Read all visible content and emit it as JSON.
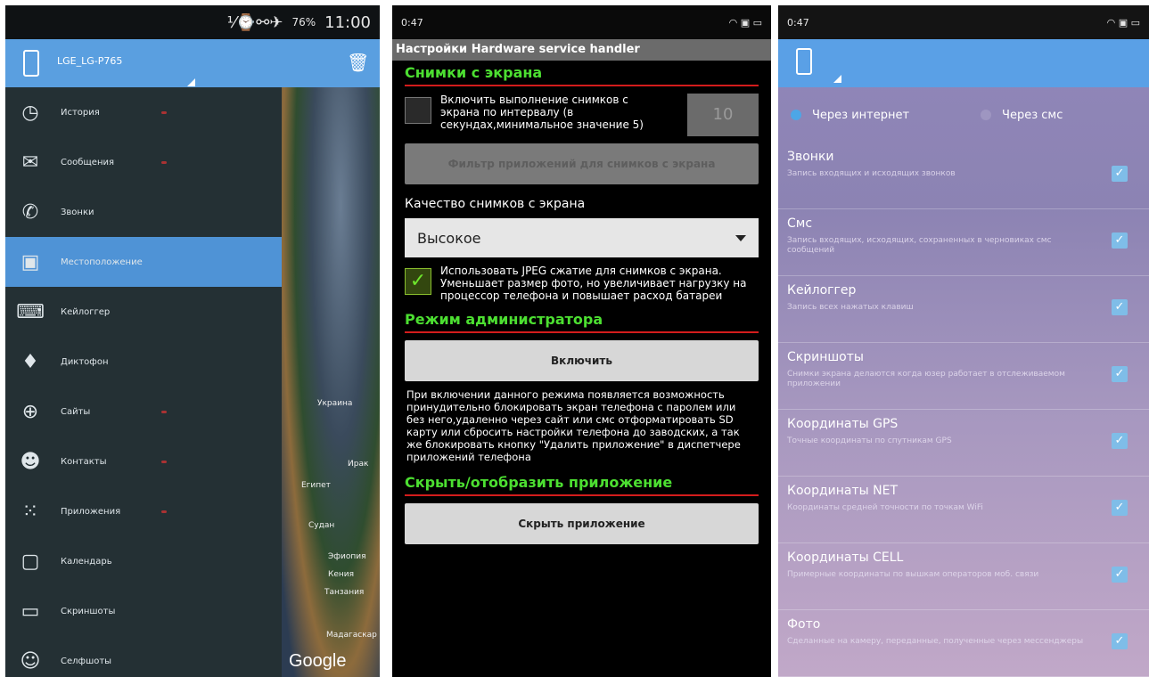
{
  "panel1": {
    "status": {
      "icons": "⅟⌚⚯✈",
      "battery": "76%",
      "time": "11:00"
    },
    "device_name": "LGE_LG-P765",
    "menu": [
      {
        "icon": "clock-icon",
        "glyph": "◷",
        "label": "История"
      },
      {
        "icon": "envelope-icon",
        "glyph": "✉",
        "label": "Сообщения"
      },
      {
        "icon": "phone-icon",
        "glyph": "✆",
        "label": "Звонки"
      },
      {
        "icon": "map-icon",
        "glyph": "▣",
        "label": "Местоположение"
      },
      {
        "icon": "keyboard-icon",
        "glyph": "⌨",
        "label": "Кейлоггер"
      },
      {
        "icon": "microphone-icon",
        "glyph": "♦",
        "label": "Диктофон"
      },
      {
        "icon": "globe-icon",
        "glyph": "⊕",
        "label": "Сайты"
      },
      {
        "icon": "contacts-icon",
        "glyph": "☻",
        "label": "Контакты"
      },
      {
        "icon": "apps-icon",
        "glyph": "⁙",
        "label": "Приложения"
      },
      {
        "icon": "calendar-icon",
        "glyph": "▢",
        "label": "Календарь"
      },
      {
        "icon": "screenshot-icon",
        "glyph": "▭",
        "label": "Скриншоты"
      },
      {
        "icon": "selfie-icon",
        "glyph": "☺",
        "label": "Селфшоты"
      }
    ],
    "map_labels": [
      "Украина",
      "Египет",
      "Судан",
      "Эфиопия",
      "Кения",
      "Танзания",
      "Ирак",
      "Мадагаскар"
    ],
    "google": "Google"
  },
  "panel2": {
    "status_time": "0:47",
    "title": "Настройки Hardware service handler",
    "section1": "Снимки с экрана",
    "interval_text": "Включить выполнение снимков с экрана по интервалу (в секундах,минимальное значение 5)",
    "interval_value": "10",
    "filter_button": "Фильтр приложений для снимков с экрана",
    "quality_label": "Качество снимков с экрана",
    "quality_value": "Высокое",
    "jpeg_text": "Использовать JPEG сжатие для снимков с экрана. Уменьшает размер фото, но увеличивает нагрузку на процессор телефона и повышает расход батареи",
    "section2": "Режим администратора",
    "enable_button": "Включить",
    "admin_desc": "При включении данного режима появляется возможность принудительно блокировать экран телефона с паролем или без него,удаленно через сайт или смс отформатировать SD карту или сбросить настройки телефона до заводских, а так же блокировать кнопку \"Удалить приложение\" в диспетчере приложений телефона",
    "section3": "Скрыть/отобразить приложение",
    "hide_button": "Скрыть приложение"
  },
  "panel3": {
    "status_time": "0:47",
    "radio_internet": "Через интернет",
    "radio_sms": "Через смс",
    "settings": [
      {
        "title": "Звонки",
        "desc": "Запись входящих и исходящих звонков"
      },
      {
        "title": "Смс",
        "desc": "Запись входящих, исходящих, сохраненных в черновиках смс сообщений"
      },
      {
        "title": "Кейлоггер",
        "desc": "Запись всех нажатых клавиш"
      },
      {
        "title": "Скриншоты",
        "desc": "Снимки экрана делаются когда юзер работает в отслеживаемом приложении"
      },
      {
        "title": "Координаты GPS",
        "desc": "Точные координаты по спутникам GPS"
      },
      {
        "title": "Координаты NET",
        "desc": "Координаты средней точности по точкам WiFi"
      },
      {
        "title": "Координаты CELL",
        "desc": "Примерные координаты по вышкам операторов моб. связи"
      },
      {
        "title": "Фото",
        "desc": "Сделанные на камеру, переданные, полученные через мессенджеры"
      }
    ]
  }
}
